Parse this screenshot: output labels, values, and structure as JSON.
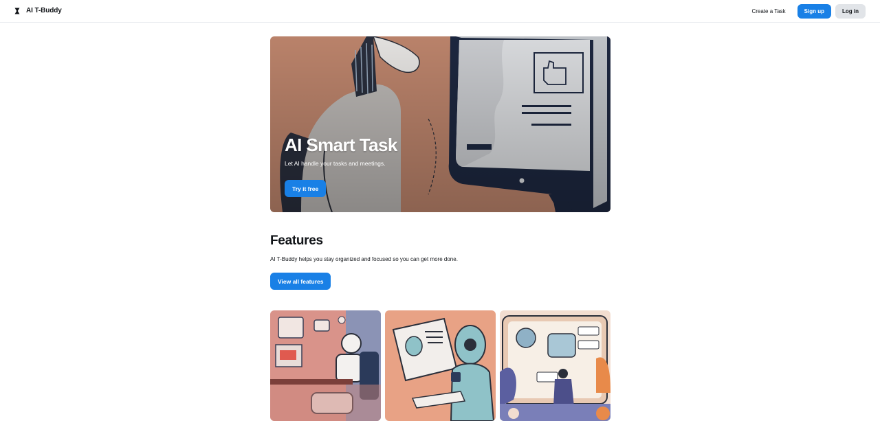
{
  "header": {
    "brand": "AI T-Buddy",
    "nav": {
      "create_task": "Create a Task"
    },
    "signup_label": "Sign up",
    "login_label": "Log in"
  },
  "hero": {
    "title": "AI Smart Task",
    "subtitle": "Let AI handle your tasks and meetings.",
    "cta_label": "Try it free"
  },
  "features": {
    "title": "Features",
    "description": "AI T-Buddy helps you stay organized and focused so you can get more done.",
    "cta_label": "View all features"
  },
  "colors": {
    "primary": "#1980e6",
    "secondary": "#e1e4e8",
    "text": "#111418",
    "hero_bg": "#c98d73"
  }
}
